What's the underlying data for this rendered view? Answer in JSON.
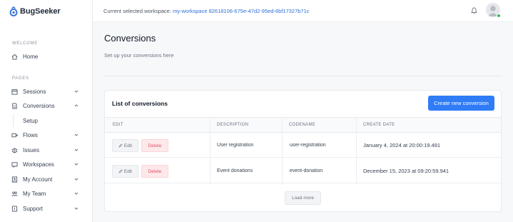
{
  "app": {
    "name": "BugSeeker"
  },
  "sidebar": {
    "sections": [
      {
        "label": "WELCOME"
      },
      {
        "label": "PAGES"
      }
    ],
    "items": [
      {
        "label": "Home",
        "icon": "home-icon"
      },
      {
        "label": "Sessions",
        "icon": "sessions-icon"
      },
      {
        "label": "Conversions",
        "icon": "document-icon",
        "expanded": true
      },
      {
        "label": "Setup",
        "sub": true
      },
      {
        "label": "Flows",
        "icon": "flows-icon"
      },
      {
        "label": "Issues",
        "icon": "bug-icon"
      },
      {
        "label": "Workspaces",
        "icon": "workspaces-icon"
      },
      {
        "label": "My Account",
        "icon": "account-icon"
      },
      {
        "label": "My Team",
        "icon": "team-icon"
      },
      {
        "label": "Support",
        "icon": "support-icon"
      }
    ]
  },
  "topbar": {
    "workspace_prefix": "Current selected workspace:",
    "workspace_id": "my-workspace 82618106-675e-47d2-95ed-6bf17327b71c"
  },
  "page": {
    "title": "Conversions",
    "subtitle": "Set up your conversions here"
  },
  "card": {
    "title": "List of conversions",
    "create_button": "Create new conversion",
    "columns": [
      "EDIT",
      "DESCRIPTION",
      "CODENAME",
      "CREATE DATE"
    ],
    "rows": [
      {
        "description": "User registration",
        "codename": "user-registration",
        "date": "January 4, 2024 at 20:00:19.491"
      },
      {
        "description": "Event donations",
        "codename": "event-donation",
        "date": "December 15, 2023 at 09:20:59.941"
      }
    ],
    "edit_label": "Edit",
    "delete_label": "Delete",
    "load_more": "Load more"
  },
  "colors": {
    "accent": "#2f7cf6",
    "danger": "#e2525f",
    "online": "#22c55e"
  }
}
